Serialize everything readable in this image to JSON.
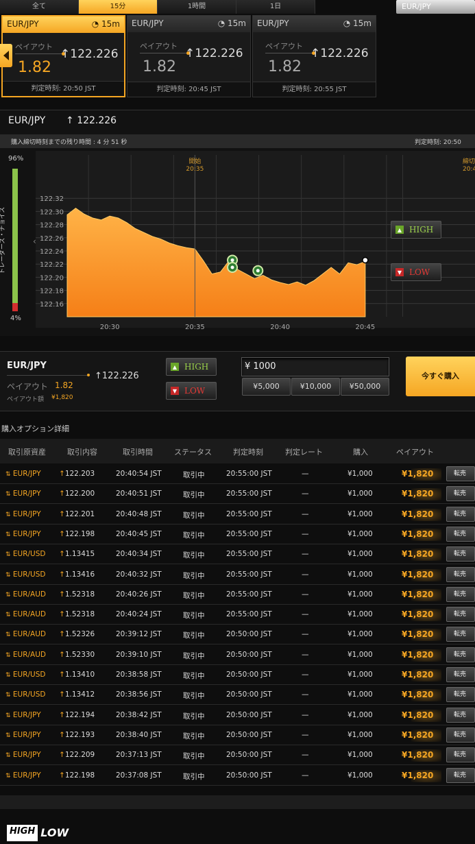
{
  "tabs": [
    {
      "label": "全て",
      "active": false
    },
    {
      "label": "15分",
      "active": true
    },
    {
      "label": "1時間",
      "active": false
    },
    {
      "label": "1日",
      "active": false
    }
  ],
  "pair_select": "EUR/JPY",
  "cards": [
    {
      "pair": "EUR/JPY",
      "duration": "15m",
      "payout_label": "ペイアウト",
      "payout": "1.82",
      "rate": "122.226",
      "judge_time": "判定時刻:  20:50 JST",
      "active": true
    },
    {
      "pair": "EUR/JPY",
      "duration": "15m",
      "payout_label": "ペイアウト",
      "payout": "1.82",
      "rate": "122.226",
      "judge_time": "判定時刻:  20:45 JST",
      "active": false
    },
    {
      "pair": "EUR/JPY",
      "duration": "15m",
      "payout_label": "ペイアウト",
      "payout": "1.82",
      "rate": "122.226",
      "judge_time": "判定時刻:  20:55 JST",
      "active": false
    }
  ],
  "chart": {
    "pair": "EUR/JPY",
    "rate": "122.226",
    "countdown": "購入締切時刻までの残り時間 : 4 分 51 秒",
    "judge_label": "判定時刻:  20:50",
    "traders_choice_label": "トレーダーズ・チョイス",
    "traders_top": "96%",
    "traders_bottom": "4%",
    "start_label": "開始",
    "start_time": "20:35",
    "close_label": "締切",
    "close_time": "20:4",
    "high_label": "HIGH",
    "low_label": "LOW"
  },
  "chart_data": {
    "type": "area",
    "yticks": [
      "122.32",
      "122.30",
      "122.28",
      "122.26",
      "122.24",
      "122.22",
      "122.20",
      "122.18",
      "122.16"
    ],
    "ylim": [
      122.14,
      122.34
    ],
    "xticks": [
      {
        "label": "20:30",
        "t": 30
      },
      {
        "label": "20:35",
        "t": 35
      },
      {
        "label": "20:40",
        "t": 40
      },
      {
        "label": "20:45",
        "t": 45
      }
    ],
    "xlim": [
      27.5,
      47.5
    ],
    "x": [
      27.5,
      28,
      28.5,
      29,
      29.5,
      30,
      30.5,
      31,
      31.5,
      32,
      32.5,
      33,
      33.5,
      34,
      34.5,
      35,
      35.5,
      36,
      36.5,
      37,
      37.5,
      38,
      38.5,
      39,
      39.5,
      40,
      40.5,
      41,
      41.5,
      42,
      42.5,
      43,
      43.5,
      44,
      44.5,
      45
    ],
    "y": [
      122.295,
      122.305,
      122.296,
      122.29,
      122.287,
      122.293,
      122.29,
      122.283,
      122.274,
      122.268,
      122.262,
      122.258,
      122.252,
      122.248,
      122.245,
      122.243,
      122.225,
      122.205,
      122.208,
      122.225,
      122.212,
      122.205,
      122.198,
      122.203,
      122.196,
      122.192,
      122.189,
      122.193,
      122.188,
      122.195,
      122.205,
      122.215,
      122.205,
      122.222,
      122.219,
      122.224
    ],
    "entries": [
      {
        "x": 37.2,
        "y": 122.226
      },
      {
        "x": 37.2,
        "y": 122.215
      },
      {
        "x": 38.7,
        "y": 122.21
      }
    ],
    "current": {
      "x": 45,
      "y": 122.226
    },
    "color": "#f5a623"
  },
  "order": {
    "pair": "EUR/JPY",
    "payout_label": "ペイアウト",
    "payout": "1.82",
    "rate": "122.226",
    "amount_label": "ペイアウト額",
    "amount": "¥1,820",
    "high_label": "HIGH",
    "low_label": "LOW",
    "input_value": "¥ 1000",
    "quick": [
      "¥5,000",
      "¥10,000",
      "¥50,000"
    ],
    "buy_label": "今すぐ購入"
  },
  "detail": {
    "title": "購入オプション詳細",
    "headers": [
      "取引原資産",
      "取引内容",
      "取引時間",
      "ステータス",
      "判定時刻",
      "判定レート",
      "購入",
      "ペイアウト"
    ],
    "sell_label": "転売",
    "rows": [
      {
        "asset": "EUR/JPY",
        "rate": "122.203",
        "time": "20:40:54 JST",
        "status": "取引中",
        "judge": "20:55:00 JST",
        "jrate": "—",
        "buy": "¥1,000",
        "payout": "¥1,820"
      },
      {
        "asset": "EUR/JPY",
        "rate": "122.200",
        "time": "20:40:51 JST",
        "status": "取引中",
        "judge": "20:55:00 JST",
        "jrate": "—",
        "buy": "¥1,000",
        "payout": "¥1,820"
      },
      {
        "asset": "EUR/JPY",
        "rate": "122.201",
        "time": "20:40:48 JST",
        "status": "取引中",
        "judge": "20:55:00 JST",
        "jrate": "—",
        "buy": "¥1,000",
        "payout": "¥1,820"
      },
      {
        "asset": "EUR/JPY",
        "rate": "122.198",
        "time": "20:40:45 JST",
        "status": "取引中",
        "judge": "20:55:00 JST",
        "jrate": "—",
        "buy": "¥1,000",
        "payout": "¥1,820"
      },
      {
        "asset": "EUR/USD",
        "rate": "1.13415",
        "time": "20:40:34 JST",
        "status": "取引中",
        "judge": "20:55:00 JST",
        "jrate": "—",
        "buy": "¥1,000",
        "payout": "¥1,820"
      },
      {
        "asset": "EUR/USD",
        "rate": "1.13416",
        "time": "20:40:32 JST",
        "status": "取引中",
        "judge": "20:55:00 JST",
        "jrate": "—",
        "buy": "¥1,000",
        "payout": "¥1,820"
      },
      {
        "asset": "EUR/AUD",
        "rate": "1.52318",
        "time": "20:40:26 JST",
        "status": "取引中",
        "judge": "20:55:00 JST",
        "jrate": "—",
        "buy": "¥1,000",
        "payout": "¥1,820"
      },
      {
        "asset": "EUR/AUD",
        "rate": "1.52318",
        "time": "20:40:24 JST",
        "status": "取引中",
        "judge": "20:55:00 JST",
        "jrate": "—",
        "buy": "¥1,000",
        "payout": "¥1,820"
      },
      {
        "asset": "EUR/AUD",
        "rate": "1.52326",
        "time": "20:39:12 JST",
        "status": "取引中",
        "judge": "20:50:00 JST",
        "jrate": "—",
        "buy": "¥1,000",
        "payout": "¥1,820"
      },
      {
        "asset": "EUR/AUD",
        "rate": "1.52330",
        "time": "20:39:10 JST",
        "status": "取引中",
        "judge": "20:50:00 JST",
        "jrate": "—",
        "buy": "¥1,000",
        "payout": "¥1,820"
      },
      {
        "asset": "EUR/USD",
        "rate": "1.13410",
        "time": "20:38:58 JST",
        "status": "取引中",
        "judge": "20:50:00 JST",
        "jrate": "—",
        "buy": "¥1,000",
        "payout": "¥1,820"
      },
      {
        "asset": "EUR/USD",
        "rate": "1.13412",
        "time": "20:38:56 JST",
        "status": "取引中",
        "judge": "20:50:00 JST",
        "jrate": "—",
        "buy": "¥1,000",
        "payout": "¥1,820"
      },
      {
        "asset": "EUR/JPY",
        "rate": "122.194",
        "time": "20:38:42 JST",
        "status": "取引中",
        "judge": "20:50:00 JST",
        "jrate": "—",
        "buy": "¥1,000",
        "payout": "¥1,820"
      },
      {
        "asset": "EUR/JPY",
        "rate": "122.193",
        "time": "20:38:40 JST",
        "status": "取引中",
        "judge": "20:50:00 JST",
        "jrate": "—",
        "buy": "¥1,000",
        "payout": "¥1,820"
      },
      {
        "asset": "EUR/JPY",
        "rate": "122.209",
        "time": "20:37:13 JST",
        "status": "取引中",
        "judge": "20:50:00 JST",
        "jrate": "—",
        "buy": "¥1,000",
        "payout": "¥1,820"
      },
      {
        "asset": "EUR/JPY",
        "rate": "122.198",
        "time": "20:37:08 JST",
        "status": "取引中",
        "judge": "20:50:00 JST",
        "jrate": "—",
        "buy": "¥1,000",
        "payout": "¥1,820"
      }
    ]
  },
  "logo": {
    "high": "HIGH",
    "low": "LOW"
  }
}
